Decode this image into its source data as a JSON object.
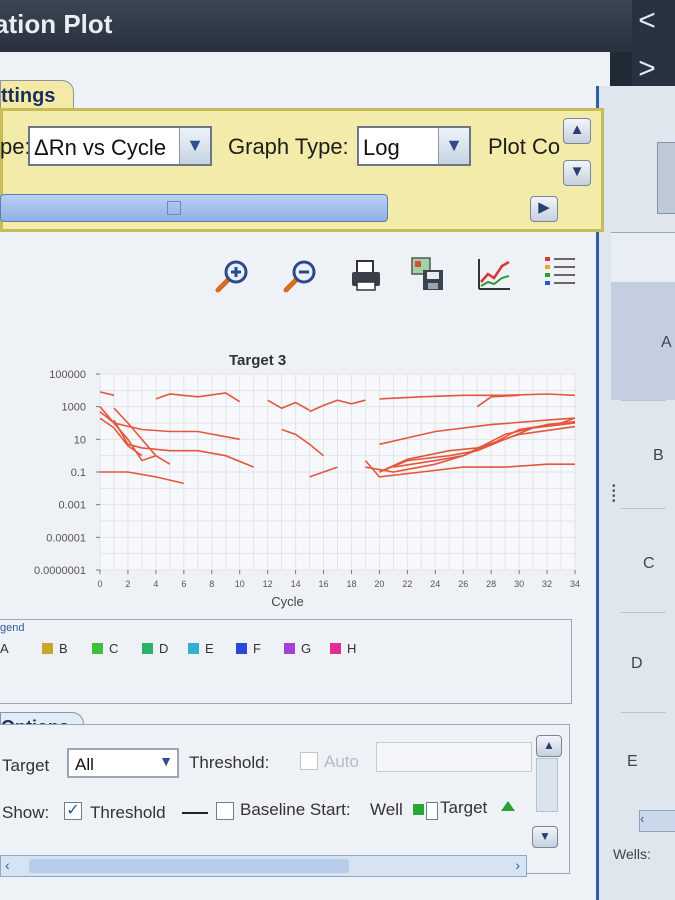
{
  "window": {
    "title": "ation Plot",
    "nav_back": "<",
    "nav_forward": ">"
  },
  "settings": {
    "tab_label": "ttings",
    "plot_type_label": "pe:",
    "plot_type_value": "ΔRn vs Cycle",
    "graph_type_label": "Graph Type:",
    "graph_type_value": "Log",
    "plot_color_label": "Plot Co"
  },
  "toolbar": {
    "icons": [
      "zoom-in-icon",
      "zoom-out-icon",
      "print-icon",
      "save-image-icon",
      "chart-icon",
      "legend-list-icon"
    ]
  },
  "chart_data": {
    "type": "line",
    "title": "Target 3",
    "xlabel": "Cycle",
    "ylabel": "",
    "yscale": "log",
    "xlim": [
      0,
      34
    ],
    "ylim": [
      1e-07,
      100000
    ],
    "x_ticks": [
      0,
      2,
      4,
      6,
      8,
      10,
      12,
      14,
      16,
      18,
      20,
      22,
      24,
      26,
      28,
      30,
      32,
      34
    ],
    "y_ticks": [
      {
        "label": "100000",
        "value": 100000
      },
      {
        "label": "1000",
        "value": 1000
      },
      {
        "label": "10",
        "value": 10
      },
      {
        "label": "0.1",
        "value": 0.1
      },
      {
        "label": "0.001",
        "value": 0.001
      },
      {
        "label": "0.00001",
        "value": 1e-05
      },
      {
        "label": "0.0000001",
        "value": 1e-07
      }
    ],
    "grid": true,
    "line_color": "#e4573c",
    "series": [
      {
        "x": [
          0,
          1
        ],
        "y": [
          8000,
          5000
        ]
      },
      {
        "x": [
          4,
          5,
          7,
          9,
          10
        ],
        "y": [
          3000,
          6000,
          4000,
          7000,
          2000
        ]
      },
      {
        "x": [
          12,
          13,
          14,
          15
        ],
        "y": [
          2500,
          800,
          1800,
          600
        ]
      },
      {
        "x": [
          15,
          16,
          17,
          18,
          19
        ],
        "y": [
          500,
          1200,
          2500,
          1500,
          2500
        ]
      },
      {
        "x": [
          20,
          23,
          26,
          29,
          32,
          34
        ],
        "y": [
          3000,
          4000,
          5000,
          5000,
          6000,
          5000
        ]
      },
      {
        "x": [
          27,
          28,
          30
        ],
        "y": [
          1000,
          4000,
          5000
        ]
      },
      {
        "x": [
          0,
          1,
          3,
          5,
          7,
          10
        ],
        "y": [
          500,
          100,
          40,
          30,
          30,
          10
        ]
      },
      {
        "x": [
          0,
          1,
          2,
          3
        ],
        "y": [
          200,
          50,
          4,
          1
        ]
      },
      {
        "x": [
          1,
          2,
          3,
          5,
          7,
          9,
          11
        ],
        "y": [
          150,
          5,
          3,
          2,
          2,
          1,
          0.2
        ]
      },
      {
        "x": [
          1,
          2,
          3,
          4,
          5
        ],
        "y": [
          800,
          100,
          10,
          1,
          0.3
        ]
      },
      {
        "x": [
          0,
          2,
          3,
          4
        ],
        "y": [
          1000,
          10,
          0.5,
          1
        ]
      },
      {
        "x": [
          0,
          2,
          4,
          6
        ],
        "y": [
          0.1,
          0.1,
          0.05,
          0.02
        ]
      },
      {
        "x": [
          13,
          14,
          15,
          16
        ],
        "y": [
          40,
          20,
          5,
          1
        ]
      },
      {
        "x": [
          15,
          16,
          17
        ],
        "y": [
          0.05,
          0.1,
          0.2
        ]
      },
      {
        "x": [
          19,
          20,
          23,
          26,
          29,
          32,
          34
        ],
        "y": [
          0.5,
          0.05,
          0.1,
          0.2,
          0.2,
          0.3,
          0.3
        ]
      },
      {
        "x": [
          19,
          21,
          24,
          26,
          28,
          30,
          33,
          34
        ],
        "y": [
          0.2,
          0.1,
          0.3,
          1,
          5,
          40,
          100,
          200
        ]
      },
      {
        "x": [
          20,
          22,
          25,
          27,
          29,
          31,
          34
        ],
        "y": [
          0.1,
          0.5,
          1,
          2,
          10,
          50,
          100
        ]
      },
      {
        "x": [
          20,
          22,
          25,
          27,
          30,
          34
        ],
        "y": [
          0.1,
          0.6,
          2,
          3,
          20,
          60
        ]
      },
      {
        "x": [
          21,
          24,
          26,
          29,
          32,
          34
        ],
        "y": [
          0.2,
          0.5,
          1,
          20,
          80,
          120
        ]
      },
      {
        "x": [
          20,
          24,
          28,
          32,
          34
        ],
        "y": [
          5,
          30,
          80,
          150,
          200
        ]
      }
    ]
  },
  "legend": {
    "label": "gend",
    "items": [
      {
        "label": "A",
        "color": ""
      },
      {
        "label": "B",
        "color": "#c9a72b"
      },
      {
        "label": "C",
        "color": "#3fbf3a"
      },
      {
        "label": "D",
        "color": "#28b36b"
      },
      {
        "label": "E",
        "color": "#2fb1d0"
      },
      {
        "label": "F",
        "color": "#2a48d8"
      },
      {
        "label": "G",
        "color": "#a63fd6"
      },
      {
        "label": "H",
        "color": "#e12f8f"
      }
    ]
  },
  "options": {
    "tab_label": "Options",
    "target_label": "Target",
    "target_value": "All",
    "threshold_label": "Threshold:",
    "auto_label": "Auto",
    "show_label": "Show:",
    "threshold_checkbox_label": "Threshold",
    "threshold_checked": "✓",
    "baseline_start_label": "Baseline Start:",
    "well_label": "Well",
    "target_legend_label": "Target"
  },
  "well_grid": {
    "rows": [
      "A",
      "B",
      "C",
      "D",
      "E"
    ],
    "wells_label": "Wells:"
  }
}
